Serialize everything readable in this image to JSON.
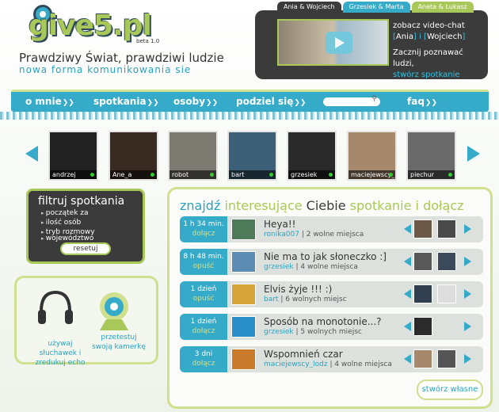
{
  "header": {
    "logo": "give5.pl",
    "beta": "beta 1.0",
    "tagline": "Prawdziwy Świat, prawdziwi ludzie",
    "subtagline": "nowa forma komunikowania sie"
  },
  "video": {
    "tabs": [
      "Ania & Wojciech",
      "Grzesiek & Marta",
      "Aneta & Łukasz"
    ],
    "line1": "zobacz video-chat",
    "names_prefix": "[",
    "name1": "Ania",
    "names_mid": "] i [",
    "name2": "Wojciech",
    "names_suffix": "]",
    "line2": "Zacznij poznawać ludzi,",
    "cta": "stwórz spotkanie"
  },
  "nav": [
    "o mnie",
    "spotkania",
    "osoby",
    "podziel się",
    "faq"
  ],
  "users": [
    "andrzej",
    "Ane_a",
    "robot",
    "bart",
    "grzesiek",
    "maciejewscy_lo",
    "piechur"
  ],
  "filter": {
    "title": "filtruj spotkania",
    "options": [
      "początek za",
      "ilość osób",
      "tryb rozmowy",
      "województwo"
    ],
    "reset": "resetuj"
  },
  "tools": {
    "headphones": "używaj słuchawek i zredukuj echo",
    "camera": "przetestuj swoją kamerkę"
  },
  "meetings": {
    "title_parts": [
      "znajdź",
      "interesujące",
      "Ciebie",
      "spotkanie i dołącz"
    ],
    "rows": [
      {
        "time": "1 h 34 min.",
        "action": "dołącz",
        "title": "Heya!!",
        "user": "ronika007",
        "info": "2 wolne miejsca"
      },
      {
        "time": "8 h 48 min.",
        "action": "opuść",
        "title": "Nie ma to jak słoneczko :]",
        "user": "grzesiek",
        "info": "4 wolne miejsca"
      },
      {
        "time": "1 dzień",
        "action": "opuść",
        "title": "Elvis żyje !!! :)",
        "user": "bart",
        "info": "6 wolnych miejsc"
      },
      {
        "time": "1 dzień",
        "action": "dołącz",
        "title": "Sposób na monotonie...?",
        "user": "grzesiek",
        "info": "5 wolnych miejsc"
      },
      {
        "time": "3 dni",
        "action": "dołącz",
        "title": "Wspomnień czar",
        "user": "maciejewscy_lodz",
        "info": "4 wolne miejsca"
      }
    ],
    "separator": " | ",
    "create": "stwórz własne"
  },
  "colors": {
    "accent_blue": "#36aac9",
    "accent_green": "#a9c85a",
    "dark": "#3b3b3b"
  }
}
